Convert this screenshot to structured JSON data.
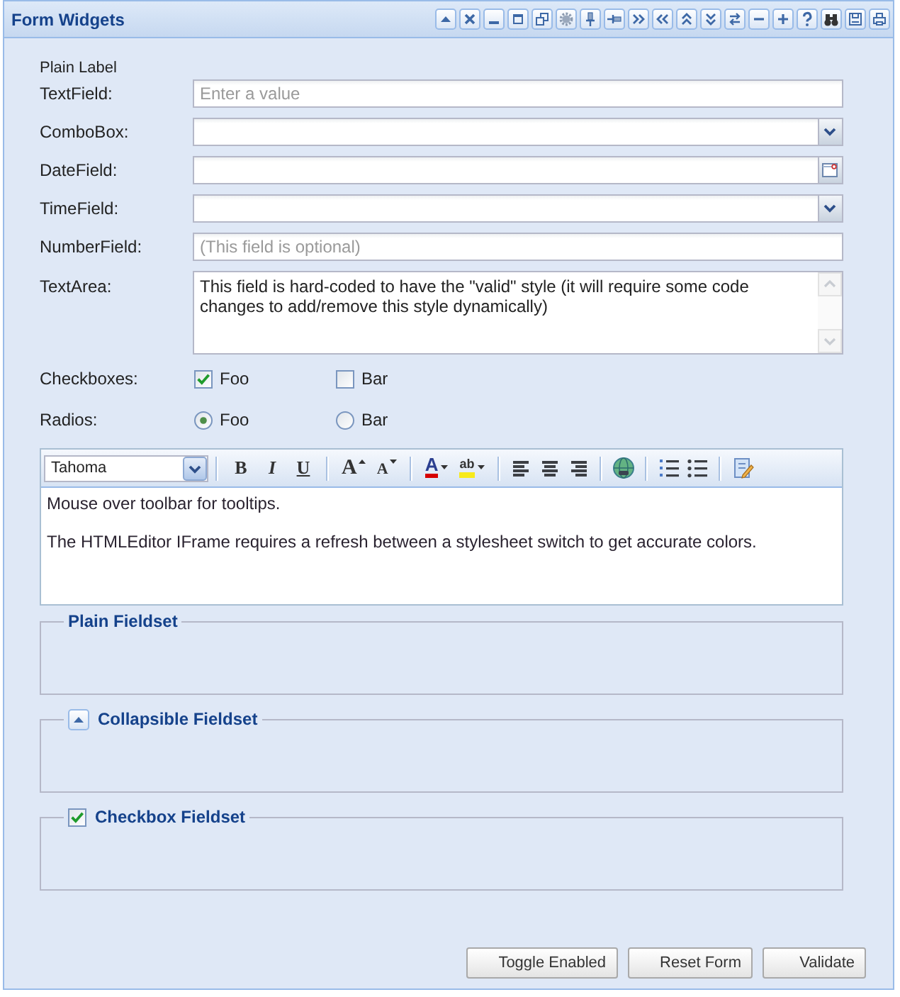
{
  "panel": {
    "title": "Form Widgets"
  },
  "form": {
    "plain_label": "Plain Label",
    "fields": [
      {
        "kind": "text",
        "label": "TextField:",
        "placeholder": "Enter a value"
      },
      {
        "kind": "combo",
        "label": "ComboBox:"
      },
      {
        "kind": "date",
        "label": "DateField:"
      },
      {
        "kind": "combo",
        "label": "TimeField:"
      },
      {
        "kind": "text",
        "label": "NumberField:",
        "placeholder": "(This field is optional)"
      },
      {
        "kind": "textarea",
        "label": "TextArea:",
        "value": "This field is hard-coded to have the \"valid\" style (it will require some code changes to add/remove this style dynamically)"
      }
    ],
    "checkboxes": {
      "label": "Checkboxes:",
      "items": [
        {
          "label": "Foo",
          "checked": true
        },
        {
          "label": "Bar",
          "checked": false
        }
      ]
    },
    "radios": {
      "label": "Radios:",
      "items": [
        {
          "label": "Foo",
          "selected": true
        },
        {
          "label": "Bar",
          "selected": false
        }
      ]
    }
  },
  "editor": {
    "font": "Tahoma",
    "style_buttons": [
      "B",
      "I",
      "U"
    ],
    "size_buttons": [
      "A",
      "A"
    ],
    "color_buttons": [
      "A",
      "ab"
    ],
    "paragraphs": [
      "Mouse over toolbar for tooltips.",
      "The HTMLEditor IFrame requires a refresh between a stylesheet switch to get accurate colors."
    ]
  },
  "fieldsets": [
    {
      "kind": "plain",
      "legend": "Plain Fieldset"
    },
    {
      "kind": "collapsible",
      "legend": "Collapsible Fieldset",
      "expanded": true
    },
    {
      "kind": "checkbox",
      "legend": "Checkbox Fieldset",
      "checked": true
    }
  ],
  "buttons": [
    "Toggle Enabled",
    "Reset Form",
    "Validate"
  ]
}
